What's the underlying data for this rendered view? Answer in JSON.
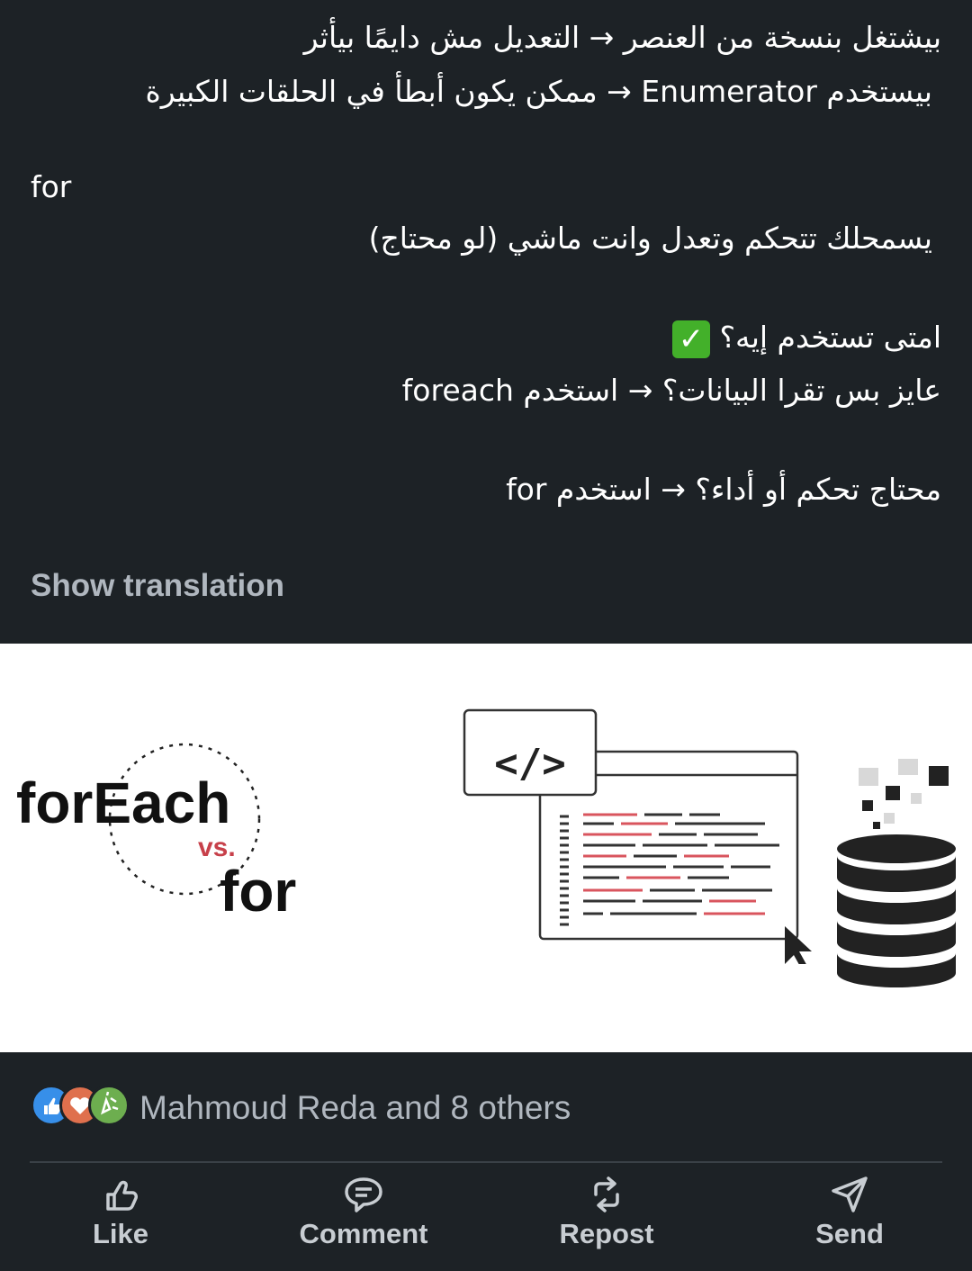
{
  "post": {
    "lines": [
      "بيشتغل بنسخة من العنصر → التعديل مش دايمًا بيأثر",
      "بيستخدم Enumerator → ممكن يكون أبطأ في الحلقات الكبيرة",
      "for",
      "يسمحلك تتحكم وتعدل وانت ماشي (لو محتاج)",
      "امتى تستخدم إيه؟",
      "عايز بس تقرا البيانات؟ → استخدم foreach",
      "محتاج تحكم أو أداء؟ → استخدم for"
    ],
    "check_mark": "✓",
    "show_translation": "Show translation"
  },
  "image": {
    "title_foreach": "forEach",
    "title_vs": "vs.",
    "title_for": "for",
    "code_tag": "</>"
  },
  "reactions": {
    "text": "Mahmoud Reda and 8 others",
    "icons": [
      "like-icon",
      "love-icon",
      "celebrate-icon"
    ]
  },
  "actions": {
    "like": "Like",
    "comment": "Comment",
    "repost": "Repost",
    "send": "Send"
  },
  "colors": {
    "background": "#1d2226",
    "muted_text": "#b0b7bf",
    "accent_red": "#c7404a",
    "check_green": "#43b02a"
  }
}
